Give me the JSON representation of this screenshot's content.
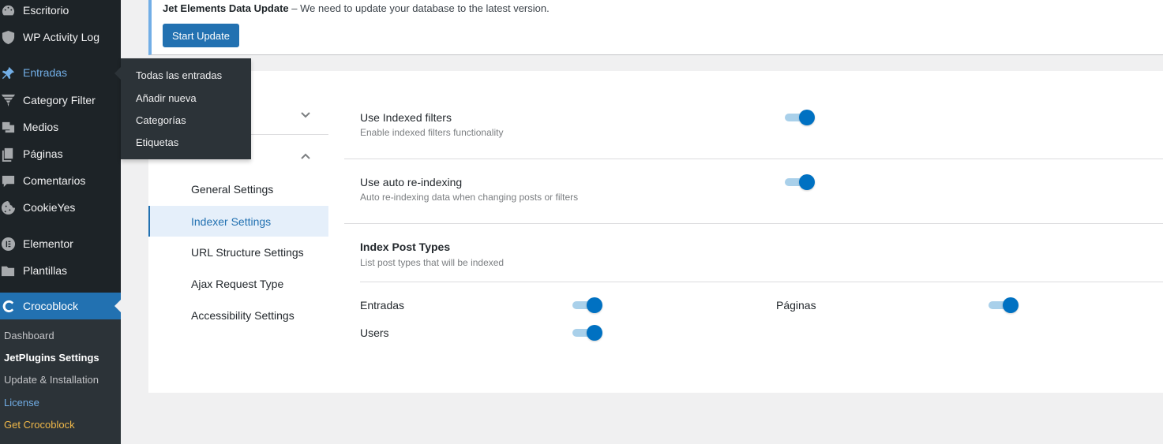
{
  "sidebar": {
    "menu": [
      {
        "label": "Escritorio",
        "icon": "dashboard-icon"
      },
      {
        "label": "WP Activity Log",
        "icon": "shield-icon"
      },
      {
        "label": "Entradas",
        "icon": "pushpin-icon"
      },
      {
        "label": "Category Filter",
        "icon": "filter-logo-icon"
      },
      {
        "label": "Medios",
        "icon": "media-icon"
      },
      {
        "label": "Páginas",
        "icon": "pages-icon"
      },
      {
        "label": "Comentarios",
        "icon": "comment-icon"
      },
      {
        "label": "CookieYes",
        "icon": "cookie-icon"
      },
      {
        "label": "Elementor",
        "icon": "elementor-icon"
      },
      {
        "label": "Plantillas",
        "icon": "folder-icon"
      },
      {
        "label": "Crocoblock",
        "icon": "crocoblock-icon"
      }
    ],
    "submenu": [
      {
        "label": "Dashboard"
      },
      {
        "label": "JetPlugins Settings"
      },
      {
        "label": "Update & Installation"
      },
      {
        "label": "License"
      },
      {
        "label": "Get Crocoblock"
      }
    ]
  },
  "flyout": {
    "items": [
      "Todas las entradas",
      "Añadir nueva",
      "Categorías",
      "Etiquetas"
    ]
  },
  "notice": {
    "title": "Jet Elements Data Update",
    "separator": " – ",
    "message": "We need to update your database to the latest version.",
    "button_label": "Start Update"
  },
  "settings_nav": {
    "items": [
      "General Settings",
      "Indexer Settings",
      "URL Structure Settings",
      "Ajax Request Type",
      "Accessibility Settings"
    ],
    "active": "Indexer Settings"
  },
  "settings": {
    "use_indexed": {
      "title": "Use Indexed filters",
      "desc": "Enable indexed filters functionality",
      "enabled": true
    },
    "auto_reindex": {
      "title": "Use auto re-indexing",
      "desc": "Auto re-indexing data when changing posts or filters",
      "enabled": true
    },
    "post_types": {
      "title": "Index Post Types",
      "desc": "List post types that will be indexed",
      "items": [
        {
          "label": "Entradas",
          "enabled": true
        },
        {
          "label": "Páginas",
          "enabled": true
        },
        {
          "label": "Users",
          "enabled": true
        }
      ]
    }
  },
  "colors": {
    "sidebar_bg": "#1d2327",
    "accent": "#2271b1",
    "toggle_on": "#0071c2"
  }
}
